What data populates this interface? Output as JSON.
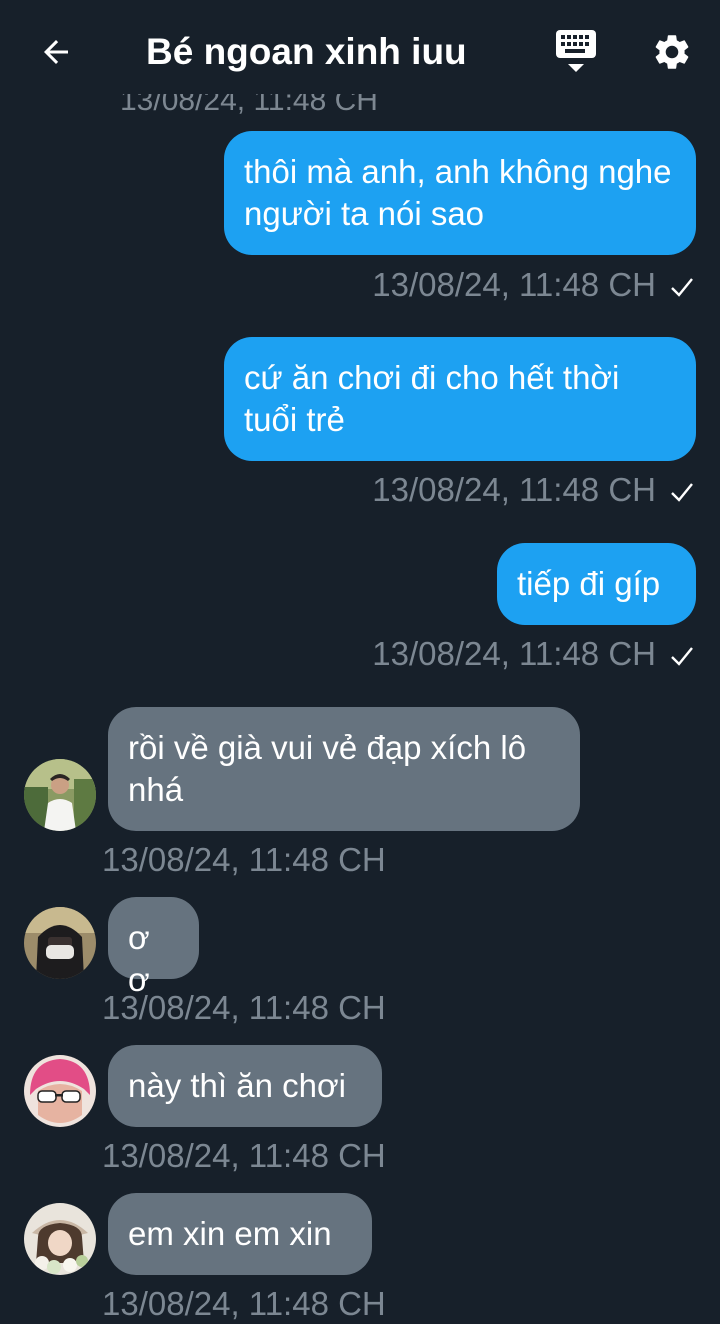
{
  "header": {
    "title": "Bé ngoan xinh iuu",
    "back_icon": "arrow-left-icon",
    "keyboard_icon": "keyboard-icon",
    "settings_icon": "gear-icon"
  },
  "colors": {
    "background": "#17202a",
    "outgoing_bubble": "#1da1f2",
    "incoming_bubble": "#66737f",
    "timestamp": "#7c8792"
  },
  "cutoff_text": "13/08/24, 11:48 CH",
  "messages": [
    {
      "direction": "outgoing",
      "text": "thôi mà anh, anh không nghe người ta nói sao",
      "time": "13/08/24, 11:48 CH",
      "status": "sent"
    },
    {
      "direction": "outgoing",
      "text": "cứ ăn chơi đi cho hết thời tuổi trẻ",
      "time": "13/08/24, 11:48 CH",
      "status": "sent"
    },
    {
      "direction": "outgoing",
      "text": "tiếp đi gíp",
      "time": "13/08/24, 11:48 CH",
      "status": "sent"
    },
    {
      "direction": "incoming",
      "text": "rồi về già vui vẻ đạp xích lô nhá",
      "time": "13/08/24, 11:48 CH",
      "avatar": "avatar-man-white-shirt"
    },
    {
      "direction": "incoming",
      "text": "ơ ơ",
      "time": "13/08/24, 11:48 CH",
      "avatar": "avatar-person-black-hood-mask"
    },
    {
      "direction": "incoming",
      "text": "này thì ăn chơi",
      "time": "13/08/24, 11:48 CH",
      "avatar": "avatar-pink-hair-sunglasses"
    },
    {
      "direction": "incoming",
      "text": "em xin em xin",
      "time": "13/08/24, 11:48 CH",
      "avatar": "avatar-girl-hat-flowers"
    }
  ]
}
